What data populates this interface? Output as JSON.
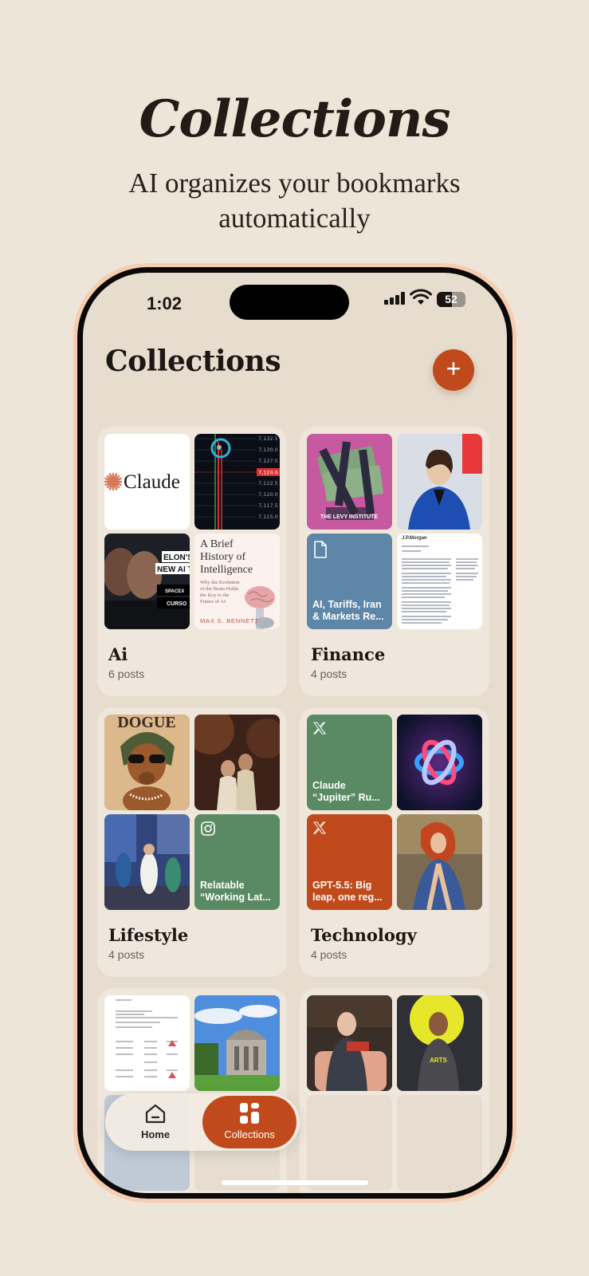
{
  "hero": {
    "title": "Collections",
    "subtitle": "AI organizes your bookmarks automatically"
  },
  "status_bar": {
    "time": "1:02",
    "battery": "52",
    "battery_level": 0.52
  },
  "header": {
    "title": "Collections",
    "add_label": "+"
  },
  "collections": [
    {
      "name": "Ai",
      "count": "6 posts",
      "thumbs": [
        {
          "kind": "logo",
          "text": "Claude"
        },
        {
          "kind": "price-chart",
          "prices": [
            "7,132.5",
            "7,130.0",
            "7,127.5",
            "7,124.6",
            "7,122.5",
            "7,120.0",
            "7,117.5",
            "7,115.0"
          ]
        },
        {
          "kind": "video",
          "text1": "ELON'S",
          "text2": "NEW AI TAR",
          "badge1": "SPACEX",
          "badge2": "CURSO"
        },
        {
          "kind": "book",
          "title": "A Brief History of Intelligence",
          "subtitle": "Why the Evolution of the Brain Holds the Key to the Future of AI",
          "author": "MAX S. BENNETT"
        }
      ]
    },
    {
      "name": "Finance",
      "count": "4 posts",
      "thumbs": [
        {
          "kind": "photo",
          "text": "THE LEVY INSTITUTE"
        },
        {
          "kind": "photo"
        },
        {
          "kind": "doc",
          "text": "AI, Tariffs, Iran & Markets Re...",
          "icon": "document-icon",
          "color": "#5e86a8"
        },
        {
          "kind": "paper",
          "text": "J.P.Morgan"
        }
      ]
    },
    {
      "name": "Lifestyle",
      "count": "4 posts",
      "thumbs": [
        {
          "kind": "photo",
          "text": "DOGUE"
        },
        {
          "kind": "photo"
        },
        {
          "kind": "photo"
        },
        {
          "kind": "doc",
          "text": "Relatable “Working Lat...",
          "icon": "instagram-icon",
          "color": "#5a8a64"
        }
      ]
    },
    {
      "name": "Technology",
      "count": "4 posts",
      "thumbs": [
        {
          "kind": "doc",
          "text": "Claude “Jupiter” Ru...",
          "icon": "x-icon",
          "color": "#5a8a64"
        },
        {
          "kind": "photo"
        },
        {
          "kind": "doc",
          "text": "GPT-5.5: Big leap, one reg...",
          "icon": "x-icon",
          "color": "#c04a1c"
        },
        {
          "kind": "photo"
        }
      ]
    }
  ],
  "partial_cards": [
    {
      "thumbs": [
        "document",
        "building"
      ]
    },
    {
      "thumbs": [
        "person",
        "speaker"
      ],
      "speaker_text": "ARTS"
    }
  ],
  "tabbar": {
    "home": "Home",
    "collections": "Collections"
  }
}
